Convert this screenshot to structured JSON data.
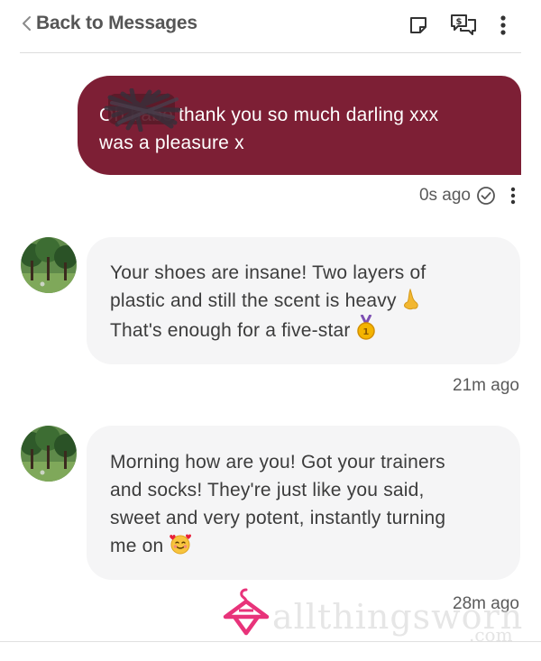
{
  "header": {
    "back_label": "Back to Messages",
    "icons": [
      "note-icon",
      "tip-chat-icon",
      "more-vertical-icon"
    ]
  },
  "messages": [
    {
      "direction": "outgoing",
      "text_line1": "Oh babe thank you so much darling xxx",
      "text_line2": "was a pleasure x",
      "time": "0s ago",
      "status": "read"
    },
    {
      "direction": "incoming",
      "text_line1": "Your shoes are insane! Two layers of",
      "text_line2": "plastic and still the scent is heavy",
      "text_line3": "That's enough for a five-star",
      "time": "21m ago"
    },
    {
      "direction": "incoming",
      "text_line1": "Morning how are you! Got your trainers",
      "text_line2": "and socks! They're just like you said,",
      "text_line3": "sweet and very potent, instantly turning",
      "text_line4": "me on",
      "time": "28m ago"
    }
  ],
  "watermark": {
    "brand": "allthingsworn",
    "suffix": ".com"
  },
  "colors": {
    "outgoing_bubble": "#7d1f35",
    "incoming_bubble": "#f5f5f6",
    "logo": "#e8337a"
  }
}
